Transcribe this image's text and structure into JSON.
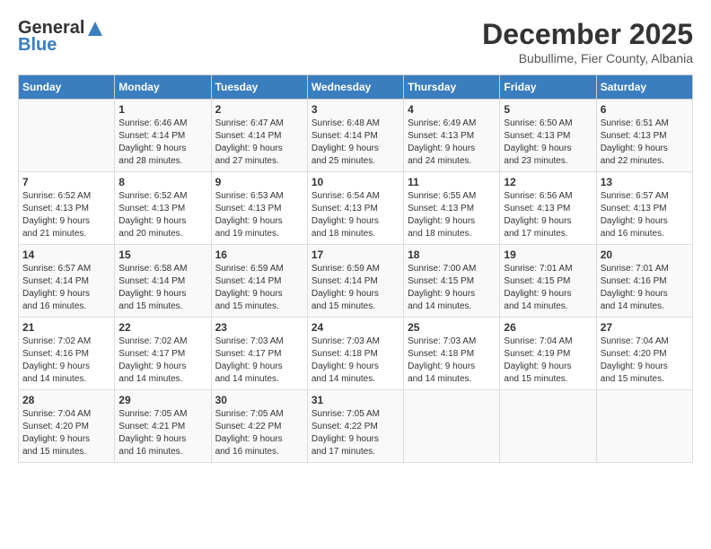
{
  "header": {
    "logo_general": "General",
    "logo_blue": "Blue",
    "month_title": "December 2025",
    "location": "Bubullime, Fier County, Albania"
  },
  "days_of_week": [
    "Sunday",
    "Monday",
    "Tuesday",
    "Wednesday",
    "Thursday",
    "Friday",
    "Saturday"
  ],
  "weeks": [
    [
      {
        "day": "",
        "info": ""
      },
      {
        "day": "1",
        "info": "Sunrise: 6:46 AM\nSunset: 4:14 PM\nDaylight: 9 hours\nand 28 minutes."
      },
      {
        "day": "2",
        "info": "Sunrise: 6:47 AM\nSunset: 4:14 PM\nDaylight: 9 hours\nand 27 minutes."
      },
      {
        "day": "3",
        "info": "Sunrise: 6:48 AM\nSunset: 4:14 PM\nDaylight: 9 hours\nand 25 minutes."
      },
      {
        "day": "4",
        "info": "Sunrise: 6:49 AM\nSunset: 4:13 PM\nDaylight: 9 hours\nand 24 minutes."
      },
      {
        "day": "5",
        "info": "Sunrise: 6:50 AM\nSunset: 4:13 PM\nDaylight: 9 hours\nand 23 minutes."
      },
      {
        "day": "6",
        "info": "Sunrise: 6:51 AM\nSunset: 4:13 PM\nDaylight: 9 hours\nand 22 minutes."
      }
    ],
    [
      {
        "day": "7",
        "info": "Sunrise: 6:52 AM\nSunset: 4:13 PM\nDaylight: 9 hours\nand 21 minutes."
      },
      {
        "day": "8",
        "info": "Sunrise: 6:52 AM\nSunset: 4:13 PM\nDaylight: 9 hours\nand 20 minutes."
      },
      {
        "day": "9",
        "info": "Sunrise: 6:53 AM\nSunset: 4:13 PM\nDaylight: 9 hours\nand 19 minutes."
      },
      {
        "day": "10",
        "info": "Sunrise: 6:54 AM\nSunset: 4:13 PM\nDaylight: 9 hours\nand 18 minutes."
      },
      {
        "day": "11",
        "info": "Sunrise: 6:55 AM\nSunset: 4:13 PM\nDaylight: 9 hours\nand 18 minutes."
      },
      {
        "day": "12",
        "info": "Sunrise: 6:56 AM\nSunset: 4:13 PM\nDaylight: 9 hours\nand 17 minutes."
      },
      {
        "day": "13",
        "info": "Sunrise: 6:57 AM\nSunset: 4:13 PM\nDaylight: 9 hours\nand 16 minutes."
      }
    ],
    [
      {
        "day": "14",
        "info": "Sunrise: 6:57 AM\nSunset: 4:14 PM\nDaylight: 9 hours\nand 16 minutes."
      },
      {
        "day": "15",
        "info": "Sunrise: 6:58 AM\nSunset: 4:14 PM\nDaylight: 9 hours\nand 15 minutes."
      },
      {
        "day": "16",
        "info": "Sunrise: 6:59 AM\nSunset: 4:14 PM\nDaylight: 9 hours\nand 15 minutes."
      },
      {
        "day": "17",
        "info": "Sunrise: 6:59 AM\nSunset: 4:14 PM\nDaylight: 9 hours\nand 15 minutes."
      },
      {
        "day": "18",
        "info": "Sunrise: 7:00 AM\nSunset: 4:15 PM\nDaylight: 9 hours\nand 14 minutes."
      },
      {
        "day": "19",
        "info": "Sunrise: 7:01 AM\nSunset: 4:15 PM\nDaylight: 9 hours\nand 14 minutes."
      },
      {
        "day": "20",
        "info": "Sunrise: 7:01 AM\nSunset: 4:16 PM\nDaylight: 9 hours\nand 14 minutes."
      }
    ],
    [
      {
        "day": "21",
        "info": "Sunrise: 7:02 AM\nSunset: 4:16 PM\nDaylight: 9 hours\nand 14 minutes."
      },
      {
        "day": "22",
        "info": "Sunrise: 7:02 AM\nSunset: 4:17 PM\nDaylight: 9 hours\nand 14 minutes."
      },
      {
        "day": "23",
        "info": "Sunrise: 7:03 AM\nSunset: 4:17 PM\nDaylight: 9 hours\nand 14 minutes."
      },
      {
        "day": "24",
        "info": "Sunrise: 7:03 AM\nSunset: 4:18 PM\nDaylight: 9 hours\nand 14 minutes."
      },
      {
        "day": "25",
        "info": "Sunrise: 7:03 AM\nSunset: 4:18 PM\nDaylight: 9 hours\nand 14 minutes."
      },
      {
        "day": "26",
        "info": "Sunrise: 7:04 AM\nSunset: 4:19 PM\nDaylight: 9 hours\nand 15 minutes."
      },
      {
        "day": "27",
        "info": "Sunrise: 7:04 AM\nSunset: 4:20 PM\nDaylight: 9 hours\nand 15 minutes."
      }
    ],
    [
      {
        "day": "28",
        "info": "Sunrise: 7:04 AM\nSunset: 4:20 PM\nDaylight: 9 hours\nand 15 minutes."
      },
      {
        "day": "29",
        "info": "Sunrise: 7:05 AM\nSunset: 4:21 PM\nDaylight: 9 hours\nand 16 minutes."
      },
      {
        "day": "30",
        "info": "Sunrise: 7:05 AM\nSunset: 4:22 PM\nDaylight: 9 hours\nand 16 minutes."
      },
      {
        "day": "31",
        "info": "Sunrise: 7:05 AM\nSunset: 4:22 PM\nDaylight: 9 hours\nand 17 minutes."
      },
      {
        "day": "",
        "info": ""
      },
      {
        "day": "",
        "info": ""
      },
      {
        "day": "",
        "info": ""
      }
    ]
  ]
}
